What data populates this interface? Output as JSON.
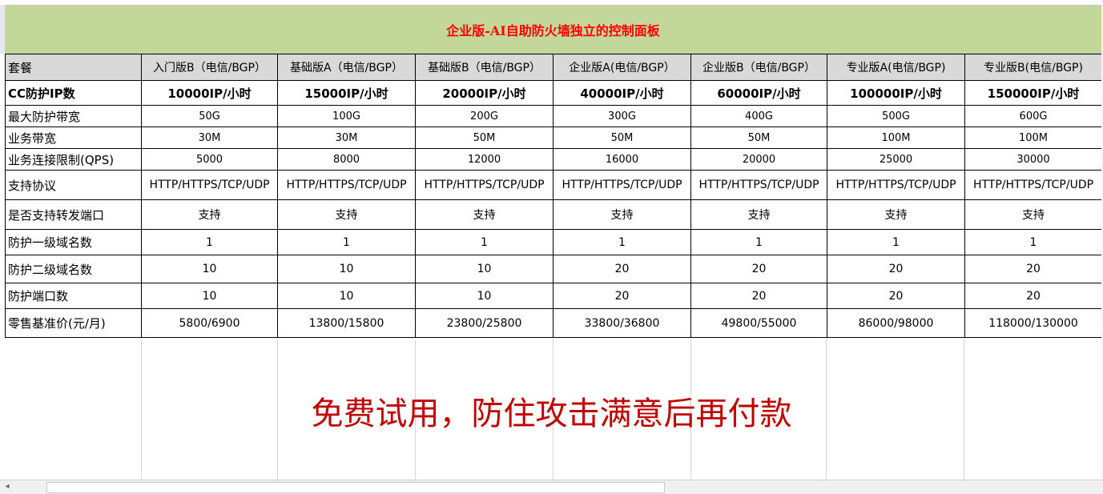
{
  "banner": {
    "title": "企业版-AI自助防火墙独立的控制面板"
  },
  "table": {
    "header": [
      "套餐",
      "入门版B（电信/BGP）",
      "基础版A（电信/BGP）",
      "基础版B（电信/BGP）",
      "企业版A(电信/BGP）",
      "企业版B（电信/BGP）",
      "专业版A(电信/BGP)",
      "专业版B(电信/BGP)"
    ],
    "rows": [
      {
        "label": "CC防护IP数",
        "cells": [
          "10000IP/小时",
          "15000IP/小时",
          "20000IP/小时",
          "40000IP/小时",
          "60000IP/小时",
          "100000IP/小时",
          "150000IP/小时"
        ]
      },
      {
        "label": "最大防护带宽",
        "cells": [
          "50G",
          "100G",
          "200G",
          "300G",
          "400G",
          "500G",
          "600G"
        ]
      },
      {
        "label": "业务带宽",
        "cells": [
          "30M",
          "30M",
          "50M",
          "50M",
          "50M",
          "100M",
          "100M"
        ]
      },
      {
        "label": "业务连接限制(QPS)",
        "cells": [
          "5000",
          "8000",
          "12000",
          "16000",
          "20000",
          "25000",
          "30000"
        ]
      },
      {
        "label": "支持协议",
        "cells": [
          "HTTP/HTTPS/TCP/UDP",
          "HTTP/HTTPS/TCP/UDP",
          "HTTP/HTTPS/TCP/UDP",
          "HTTP/HTTPS/TCP/UDP",
          "HTTP/HTTPS/TCP/UDP",
          "HTTP/HTTPS/TCP/UDP",
          "HTTP/HTTPS/TCP/UDP"
        ]
      },
      {
        "label": "是否支持转发端口",
        "cells": [
          "支持",
          "支持",
          "支持",
          "支持",
          "支持",
          "支持",
          "支持"
        ]
      },
      {
        "label": "防护一级域名数",
        "cells": [
          "1",
          "1",
          "1",
          "1",
          "1",
          "1",
          "1"
        ]
      },
      {
        "label": "防护二级域名数",
        "cells": [
          "10",
          "10",
          "10",
          "20",
          "20",
          "20",
          "20"
        ]
      },
      {
        "label": "防护端口数",
        "cells": [
          "10",
          "10",
          "10",
          "20",
          "20",
          "20",
          "20"
        ]
      },
      {
        "label": "零售基准价(元/月)",
        "cells": [
          "5800/6900",
          "13800/15800",
          "23800/25800",
          "33800/36800",
          "49800/55000",
          "86000/98000",
          "118000/130000"
        ]
      }
    ]
  },
  "promo": {
    "text": "免费试用，防住攻击满意后再付款"
  },
  "scrollbar": {
    "left_arrow_icon": "◂"
  }
}
